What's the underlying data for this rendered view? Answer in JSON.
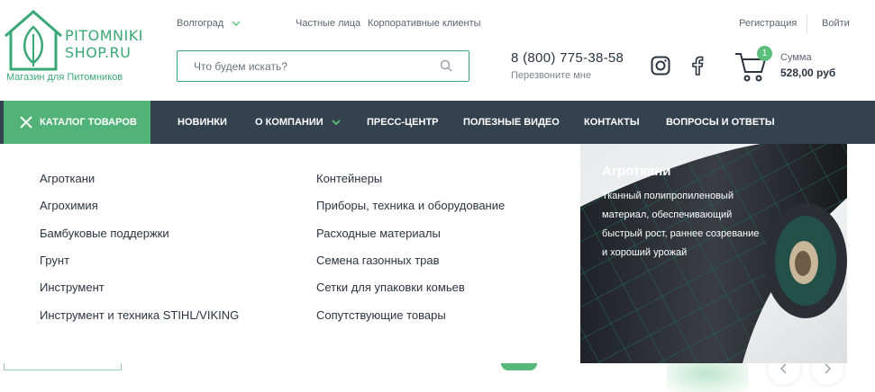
{
  "brand": {
    "logo_line1": "PITOMNIKI",
    "logo_line2": "SHOP.RU",
    "tagline": "Магазин для Питомников"
  },
  "topbar": {
    "city": "Волгоград",
    "private": "Частные лица",
    "corporate": "Корпоративные клиенты",
    "register": "Регистрация",
    "login": "Войти"
  },
  "search": {
    "placeholder": "Что будем искать?"
  },
  "contacts": {
    "phone": "8 (800) 775-38-58",
    "callback": "Перезвоните мне"
  },
  "cart": {
    "count": "1",
    "sum_label": "Сумма",
    "sum_value": "528,00 руб"
  },
  "nav": {
    "catalog": "КАТАЛОГ ТОВАРОВ",
    "items": [
      "НОВИНКИ",
      "О КОМПАНИИ",
      "ПРЕСС-ЦЕНТР",
      "ПОЛЕЗНЫЕ ВИДЕО",
      "КОНТАКТЫ",
      "ВОПРОСЫ И ОТВЕТЫ"
    ]
  },
  "catalog_menu": {
    "left": [
      "Агроткани",
      "Агрохимия",
      "Бамбуковые поддержки",
      "Грунт",
      "Инструмент",
      "Инструмент и техника STIHL/VIKING"
    ],
    "right": [
      "Контейнеры",
      "Приборы, техника и оборудование",
      "Расходные материалы",
      "Семена газонных трав",
      "Сетки для упаковки комьев",
      "Сопутствующие товары"
    ]
  },
  "promo": {
    "title": "Агроткани",
    "text": "Тканный полипропиленовый материал, обеспечивающий быстрый рост, раннее созревание и хороший урожай"
  },
  "colors": {
    "accent": "#52b378",
    "nav_bg": "#34414e",
    "text": "#2b3440"
  }
}
